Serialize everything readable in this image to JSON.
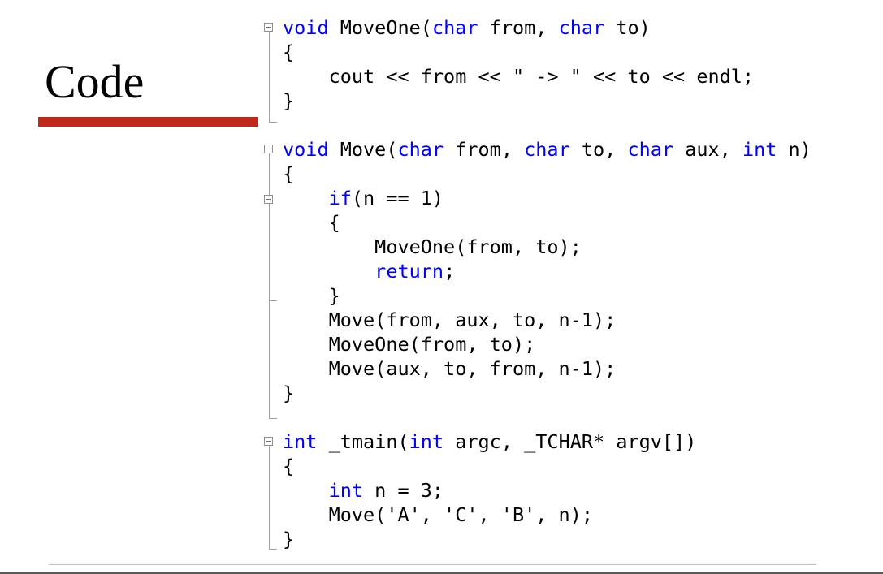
{
  "slide": {
    "title": "Code",
    "accent_color": "#c0281a"
  },
  "code": {
    "keyword_color": "#0000ff",
    "lines": [
      [
        "void",
        " MoveOne(",
        "char",
        " from, ",
        "char",
        " to)"
      ],
      [
        "{"
      ],
      [
        "cout << from << \" -> \" << to << endl;"
      ],
      [
        "}"
      ],
      [],
      [
        "void",
        " Move(",
        "char",
        " from, ",
        "char",
        " to, ",
        "char",
        " aux, ",
        "int",
        " n)"
      ],
      [
        "{"
      ],
      [
        "if",
        "(n == 1)"
      ],
      [
        "{"
      ],
      [
        "MoveOne(from, to);"
      ],
      [
        "return",
        ";"
      ],
      [
        "}"
      ],
      [
        "Move(from, aux, to, n-1);"
      ],
      [
        "MoveOne(from, to);"
      ],
      [
        "Move(aux, to, from, n-1);"
      ],
      [
        "}"
      ],
      [],
      [
        "int",
        " _tmain(",
        "int",
        " argc, _TCHAR* argv[])"
      ],
      [
        "{"
      ],
      [
        "int",
        " n = 3;"
      ],
      [
        "Move('A', 'C', 'B', n);"
      ],
      [
        "}"
      ]
    ]
  }
}
